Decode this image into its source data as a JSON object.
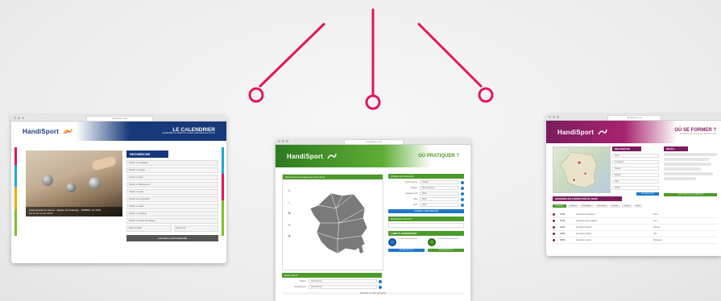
{
  "colors": {
    "accent_pink": "#e3145d",
    "calendar_blue": "#17397a",
    "pratiquer_green": "#4c9a2a",
    "former_purple": "#7b1c5e"
  },
  "icons": [
    "handisport-logo-icon",
    "location-pin-icon",
    "circle-connector-icon"
  ],
  "left_window": {
    "url": "handisport.org",
    "logo": "HandiSport",
    "title": "LE CALENDRIER",
    "subtitle": "ÉVÈNEMENTS SPORTIFS HANDI, BIENVENUE ET PLUS",
    "search_heading": "RECHERCHE",
    "photo_caption": "Championnat de France - Boules de Pétanque - TARBES, 10 JUIN",
    "photo_date": "Du 10 au 12 juin 2015",
    "filters": [
      "Choisir une catégorie",
      "Choisir une région",
      "Choisir un sport",
      "Choisir un département",
      "Choisir une date",
      "Choisir une compétition",
      "Choisir un public",
      "Choisir un handicap",
      "Choisir un niveau de pratique"
    ],
    "date_from": "Date de début",
    "date_to": "Date de fin",
    "submit": "LANCER LA RECHERCHE"
  },
  "center_window": {
    "url": "handisport.org",
    "logo": "HandiSport",
    "title": "OÙ PRATIQUER ?",
    "map_heading": "Sélectionnez la région de votre choix",
    "criteria_heading": "Critères de recherche",
    "criteria_labels": [
      "Type de sport",
      "Région",
      "Département",
      "Ville",
      "Club"
    ],
    "criteria_values": [
      "Choisir",
      "Île-de-France",
      "Paris",
      "Paris",
      "Tous"
    ],
    "search_button": "LANCER LA RECHERCHE",
    "name_search_heading": "Recherche par nom",
    "labels_heading": "LABELS HANDISPORT",
    "badge_left_text": "Le label Club Handisport",
    "badge_right_text": "Le label Activité Handisport",
    "badge_left_button": "EN SAVOIR PLUS",
    "badge_right_button": "EN SAVOIR PLUS",
    "bottom_heading": "Accès direct",
    "bottom_fields": [
      "Région",
      "Département"
    ],
    "bottom_values": [
      "Sélectionner",
      "Sélectionner"
    ],
    "footer_text": "Résultats de votre recherche"
  },
  "right_window": {
    "url": "handisport.org",
    "logo": "HandiSport",
    "title": "OÙ SE FORMER ?",
    "subtitle": "FORMATIONS POUR LE HANDISPORT",
    "search_heading": "RECHERCHE",
    "info_heading": "INFOS !",
    "filters": [
      "Sport",
      "Formation",
      "Niveau",
      "Région",
      "Date",
      "Public"
    ],
    "search_button": "RECHERCHER",
    "results_heading": "SESSIONS DE FORMATION DU MOIS",
    "tabs": [
      "Septembre",
      "Octobre",
      "Novembre",
      "Décembre",
      "Janvier",
      "Février",
      "Mars"
    ],
    "rows": [
      {
        "date": "12/09",
        "name": "Formation handisport",
        "place": "Paris"
      },
      {
        "date": "15/09",
        "name": "Formation sport adapté",
        "place": "Lyon"
      },
      {
        "date": "19/09",
        "name": "Formation boccia",
        "place": "Nantes"
      },
      {
        "date": "22/09",
        "name": "Formation basket",
        "place": "Lille"
      },
      {
        "date": "26/09",
        "name": "Formation tennis",
        "place": "Bordeaux"
      }
    ],
    "more_button": "VOIR TOUTES LES FORMATIONS"
  }
}
